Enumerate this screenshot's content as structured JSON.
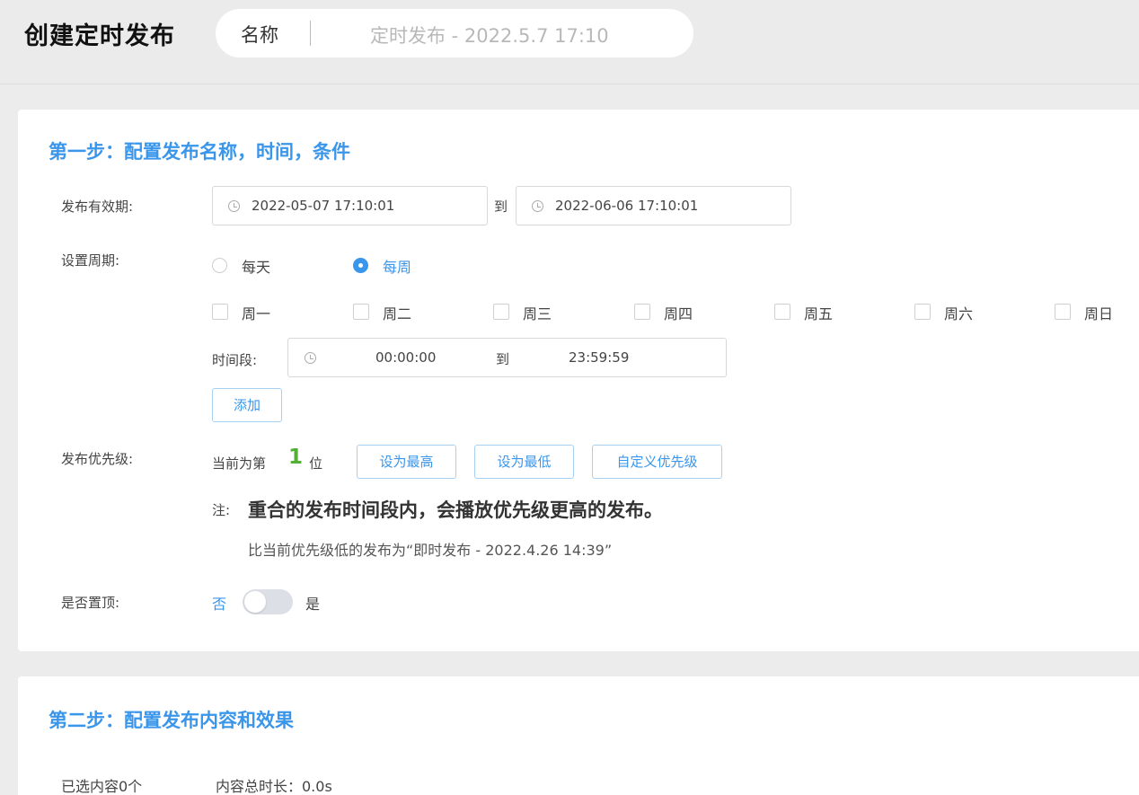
{
  "header": {
    "title": "创建定时发布",
    "name_label": "名称",
    "name_value": "定时发布 - 2022.5.7 17:10"
  },
  "step1": {
    "title": "第一步：配置发布名称，时间，条件",
    "validity": {
      "label": "发布有效期:",
      "start": "2022-05-07 17:10:01",
      "to": "到",
      "end": "2022-06-06 17:10:01"
    },
    "period": {
      "label": "设置周期:",
      "options": [
        {
          "label": "每天",
          "selected": false
        },
        {
          "label": "每周",
          "selected": true
        }
      ],
      "weekdays": [
        "周一",
        "周二",
        "周三",
        "周四",
        "周五",
        "周六",
        "周日"
      ]
    },
    "time_range": {
      "label": "时间段:",
      "start": "00:00:00",
      "to": "到",
      "end": "23:59:59"
    },
    "add_button": "添加",
    "priority": {
      "label": "发布优先级:",
      "current_prefix": "当前为第",
      "rank": "1",
      "current_suffix": "位",
      "btn_highest": "设为最高",
      "btn_lowest": "设为最低",
      "btn_custom": "自定义优先级"
    },
    "note": {
      "prefix": "注:",
      "main": "重合的发布时间段内，会播放优先级更高的发布。",
      "sub": "比当前优先级低的发布为“即时发布 - 2022.4.26 14:39”"
    },
    "pin_top": {
      "label": "是否置顶:",
      "off_label": "否",
      "on_label": "是",
      "enabled": false
    }
  },
  "step2": {
    "title": "第二步：配置发布内容和效果",
    "selected_count": "已选内容0个",
    "total_duration": "内容总时长：0.0s"
  },
  "colors": {
    "accent": "#3a96ea",
    "rank": "#52b135"
  }
}
